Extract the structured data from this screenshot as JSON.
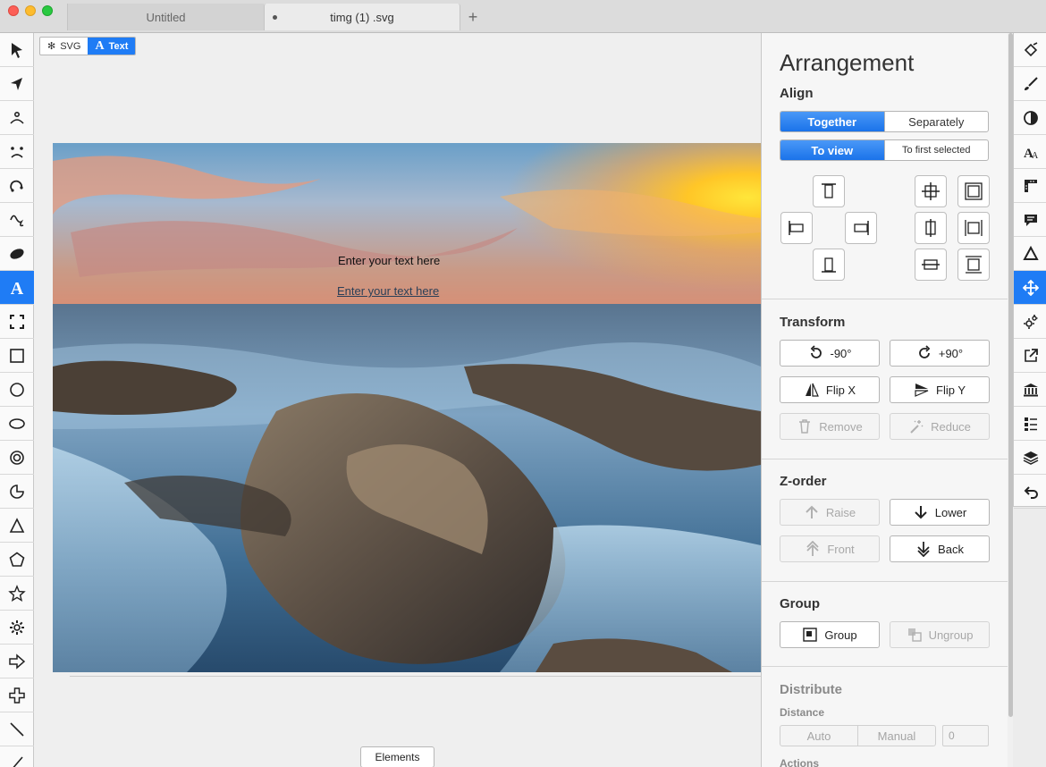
{
  "window": {
    "tabs": [
      {
        "label": "Untitled"
      },
      {
        "label": "timg (1) .svg"
      }
    ],
    "add_tab": "+"
  },
  "left_tools": [
    {
      "name": "select-arrow-icon"
    },
    {
      "name": "node-select-icon"
    },
    {
      "name": "bezier-curve-icon"
    },
    {
      "name": "freehand-icon"
    },
    {
      "name": "spiral-icon"
    },
    {
      "name": "squiggle-pen-icon"
    },
    {
      "name": "brush-blob-icon"
    },
    {
      "name": "text-tool-icon",
      "active": true
    },
    {
      "name": "frame-bracket-icon"
    },
    {
      "name": "rectangle-icon"
    },
    {
      "name": "circle-icon"
    },
    {
      "name": "ellipse-icon"
    },
    {
      "name": "ring-icon"
    },
    {
      "name": "pie-icon"
    },
    {
      "name": "triangle-icon"
    },
    {
      "name": "pentagon-icon"
    },
    {
      "name": "star-icon"
    },
    {
      "name": "gear-icon"
    },
    {
      "name": "arrow-shape-icon"
    },
    {
      "name": "cross-shape-icon"
    },
    {
      "name": "line-icon"
    },
    {
      "name": "angle-icon"
    }
  ],
  "mode_switch": {
    "svg_label": "SVG",
    "text_label": "Text",
    "active": "Text"
  },
  "canvas": {
    "text_1": "Enter your text here",
    "text_2": "Enter your text here",
    "elements_button": "Elements"
  },
  "panel": {
    "title": "Arrangement",
    "align": {
      "heading": "Align",
      "mode": {
        "together": "Together",
        "separately": "Separately",
        "selected": "Together"
      },
      "relative": {
        "to_view": "To view",
        "to_first": "To first selected",
        "selected": "To view"
      }
    },
    "transform": {
      "heading": "Transform",
      "rotate_ccw": "-90°",
      "rotate_cw": "+90°",
      "flip_x": "Flip X",
      "flip_y": "Flip Y",
      "remove": "Remove",
      "reduce": "Reduce"
    },
    "zorder": {
      "heading": "Z-order",
      "raise": "Raise",
      "lower": "Lower",
      "front": "Front",
      "back": "Back"
    },
    "group": {
      "heading": "Group",
      "group": "Group",
      "ungroup": "Ungroup"
    },
    "distribute": {
      "heading": "Distribute",
      "distance_label": "Distance",
      "auto": "Auto",
      "manual": "Manual",
      "value": "0",
      "actions_label": "Actions"
    }
  },
  "right_tools": [
    {
      "name": "paint-bucket-icon"
    },
    {
      "name": "brush-icon"
    },
    {
      "name": "contrast-icon"
    },
    {
      "name": "font-size-icon"
    },
    {
      "name": "ruler-icon"
    },
    {
      "name": "comment-icon"
    },
    {
      "name": "triangle-outline-icon"
    },
    {
      "name": "move-arrows-icon",
      "active": true
    },
    {
      "name": "puzzle-gear-icon"
    },
    {
      "name": "export-icon"
    },
    {
      "name": "library-icon"
    },
    {
      "name": "list-icon"
    },
    {
      "name": "layers-icon"
    },
    {
      "name": "undo-icon"
    }
  ],
  "colors": {
    "accent": "#1f7cf5",
    "panel_bg": "#f6f6f6",
    "disabled_text": "#a8a8a8"
  }
}
